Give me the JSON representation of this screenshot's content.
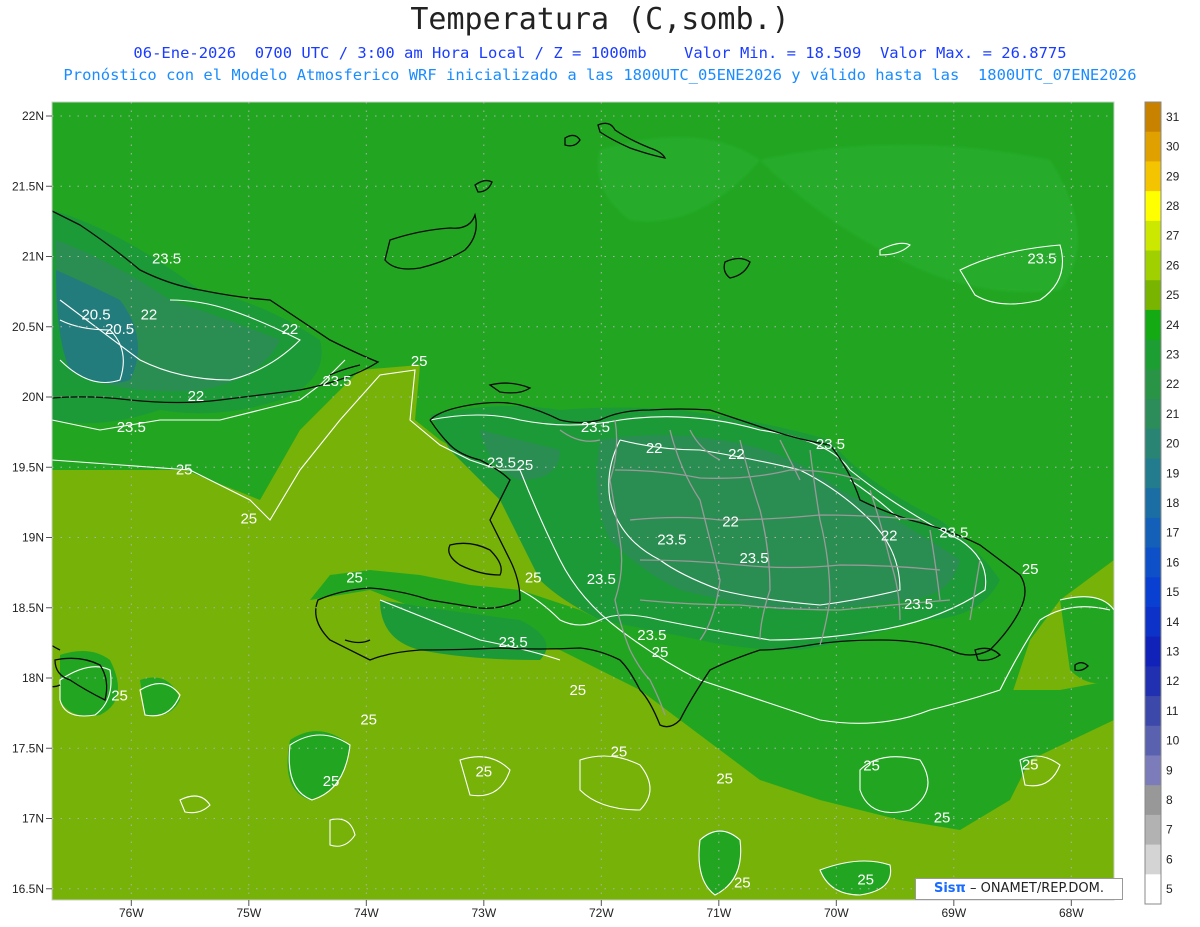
{
  "title": "Temperatura (C,somb.)",
  "subtitle_line1": "06-Ene-2026  0700 UTC / 3:00 am Hora Local / Z = 1000mb    Valor Min. = 18.509  Valor Max. = 26.8775",
  "subtitle_line2": "Pronóstico con el Modelo Atmosferico WRF inicializado a las 1800UTC_05ENE2026 y válido hasta las  1800UTC_07ENE2026",
  "lat_labels": [
    "22N",
    "21.5N",
    "21N",
    "20.5N",
    "20N",
    "19.5N",
    "19N",
    "18.5N",
    "18N",
    "17.5N",
    "17N",
    "16.5N"
  ],
  "lon_labels": [
    "76W",
    "75W",
    "74W",
    "73W",
    "72W",
    "71W",
    "70W",
    "69W",
    "68W"
  ],
  "colorbar": {
    "labels": [
      "31",
      "30",
      "29",
      "28",
      "27",
      "26",
      "25",
      "24",
      "23",
      "22",
      "21",
      "20",
      "19",
      "18",
      "17",
      "16",
      "15",
      "14",
      "13",
      "12",
      "11",
      "10",
      "9",
      "8",
      "7",
      "6",
      "5"
    ],
    "colors": [
      "#c88200",
      "#e0a000",
      "#f5c400",
      "#ffff00",
      "#cce800",
      "#a0d000",
      "#78b400",
      "#14aa14",
      "#1c9e32",
      "#2a9446",
      "#2c8c5a",
      "#2a8474",
      "#237c8e",
      "#1a6ea4",
      "#1460b8",
      "#0e50c8",
      "#0a40d2",
      "#0c32c8",
      "#1022b8",
      "#2030b0",
      "#3c48aa",
      "#5a62b0",
      "#7c7cba",
      "#989898",
      "#b2b2b2",
      "#d4d4d4",
      "#ffffff"
    ]
  },
  "contour_labels": [
    {
      "text": "23.5",
      "lon": -75.7,
      "lat": 20.95
    },
    {
      "text": "20.5",
      "lon": -76.3,
      "lat": 20.55
    },
    {
      "text": "20.5",
      "lon": -76.1,
      "lat": 20.45
    },
    {
      "text": "22",
      "lon": -75.85,
      "lat": 20.55
    },
    {
      "text": "22",
      "lon": -74.65,
      "lat": 20.45
    },
    {
      "text": "23.5",
      "lon": -74.25,
      "lat": 20.08
    },
    {
      "text": "22",
      "lon": -75.45,
      "lat": 19.97
    },
    {
      "text": "23.5",
      "lon": -76.0,
      "lat": 19.75
    },
    {
      "text": "25",
      "lon": -73.55,
      "lat": 20.22
    },
    {
      "text": "25",
      "lon": -75.55,
      "lat": 19.45
    },
    {
      "text": "25",
      "lon": -75.0,
      "lat": 19.1
    },
    {
      "text": "25",
      "lon": -72.65,
      "lat": 19.48
    },
    {
      "text": "23.5",
      "lon": -72.85,
      "lat": 19.5
    },
    {
      "text": "23.5",
      "lon": -72.05,
      "lat": 19.75
    },
    {
      "text": "22",
      "lon": -71.55,
      "lat": 19.6
    },
    {
      "text": "22",
      "lon": -70.85,
      "lat": 19.56
    },
    {
      "text": "23.5",
      "lon": -70.05,
      "lat": 19.63
    },
    {
      "text": "22",
      "lon": -70.9,
      "lat": 19.08
    },
    {
      "text": "23.5",
      "lon": -71.4,
      "lat": 18.95
    },
    {
      "text": "23.5",
      "lon": -70.7,
      "lat": 18.82
    },
    {
      "text": "22",
      "lon": -69.55,
      "lat": 18.98
    },
    {
      "text": "23.5",
      "lon": -69.0,
      "lat": 19.0
    },
    {
      "text": "23.5",
      "lon": -72.0,
      "lat": 18.67
    },
    {
      "text": "25",
      "lon": -72.58,
      "lat": 18.68
    },
    {
      "text": "25",
      "lon": -74.1,
      "lat": 18.68
    },
    {
      "text": "23.5",
      "lon": -72.75,
      "lat": 18.22
    },
    {
      "text": "23.5",
      "lon": -71.57,
      "lat": 18.27
    },
    {
      "text": "25",
      "lon": -71.5,
      "lat": 18.15
    },
    {
      "text": "23.5",
      "lon": -69.3,
      "lat": 18.49
    },
    {
      "text": "25",
      "lon": -68.35,
      "lat": 18.74
    },
    {
      "text": "25",
      "lon": -72.2,
      "lat": 17.88
    },
    {
      "text": "25",
      "lon": -73.98,
      "lat": 17.67
    },
    {
      "text": "25",
      "lon": -76.1,
      "lat": 17.84
    },
    {
      "text": "25",
      "lon": -71.85,
      "lat": 17.44
    },
    {
      "text": "25",
      "lon": -73.0,
      "lat": 17.3
    },
    {
      "text": "25",
      "lon": -74.3,
      "lat": 17.23
    },
    {
      "text": "25",
      "lon": -70.95,
      "lat": 17.25
    },
    {
      "text": "25",
      "lon": -69.7,
      "lat": 17.34
    },
    {
      "text": "25",
      "lon": -69.1,
      "lat": 16.97
    },
    {
      "text": "25",
      "lon": -68.35,
      "lat": 17.35
    },
    {
      "text": "23.5",
      "lon": -68.25,
      "lat": 20.95
    },
    {
      "text": "25",
      "lon": -70.8,
      "lat": 16.51
    },
    {
      "text": "25",
      "lon": -69.75,
      "lat": 16.53
    }
  ],
  "credit": {
    "logo": "Sisπ",
    "text": "– ONAMET/REP.DOM."
  }
}
